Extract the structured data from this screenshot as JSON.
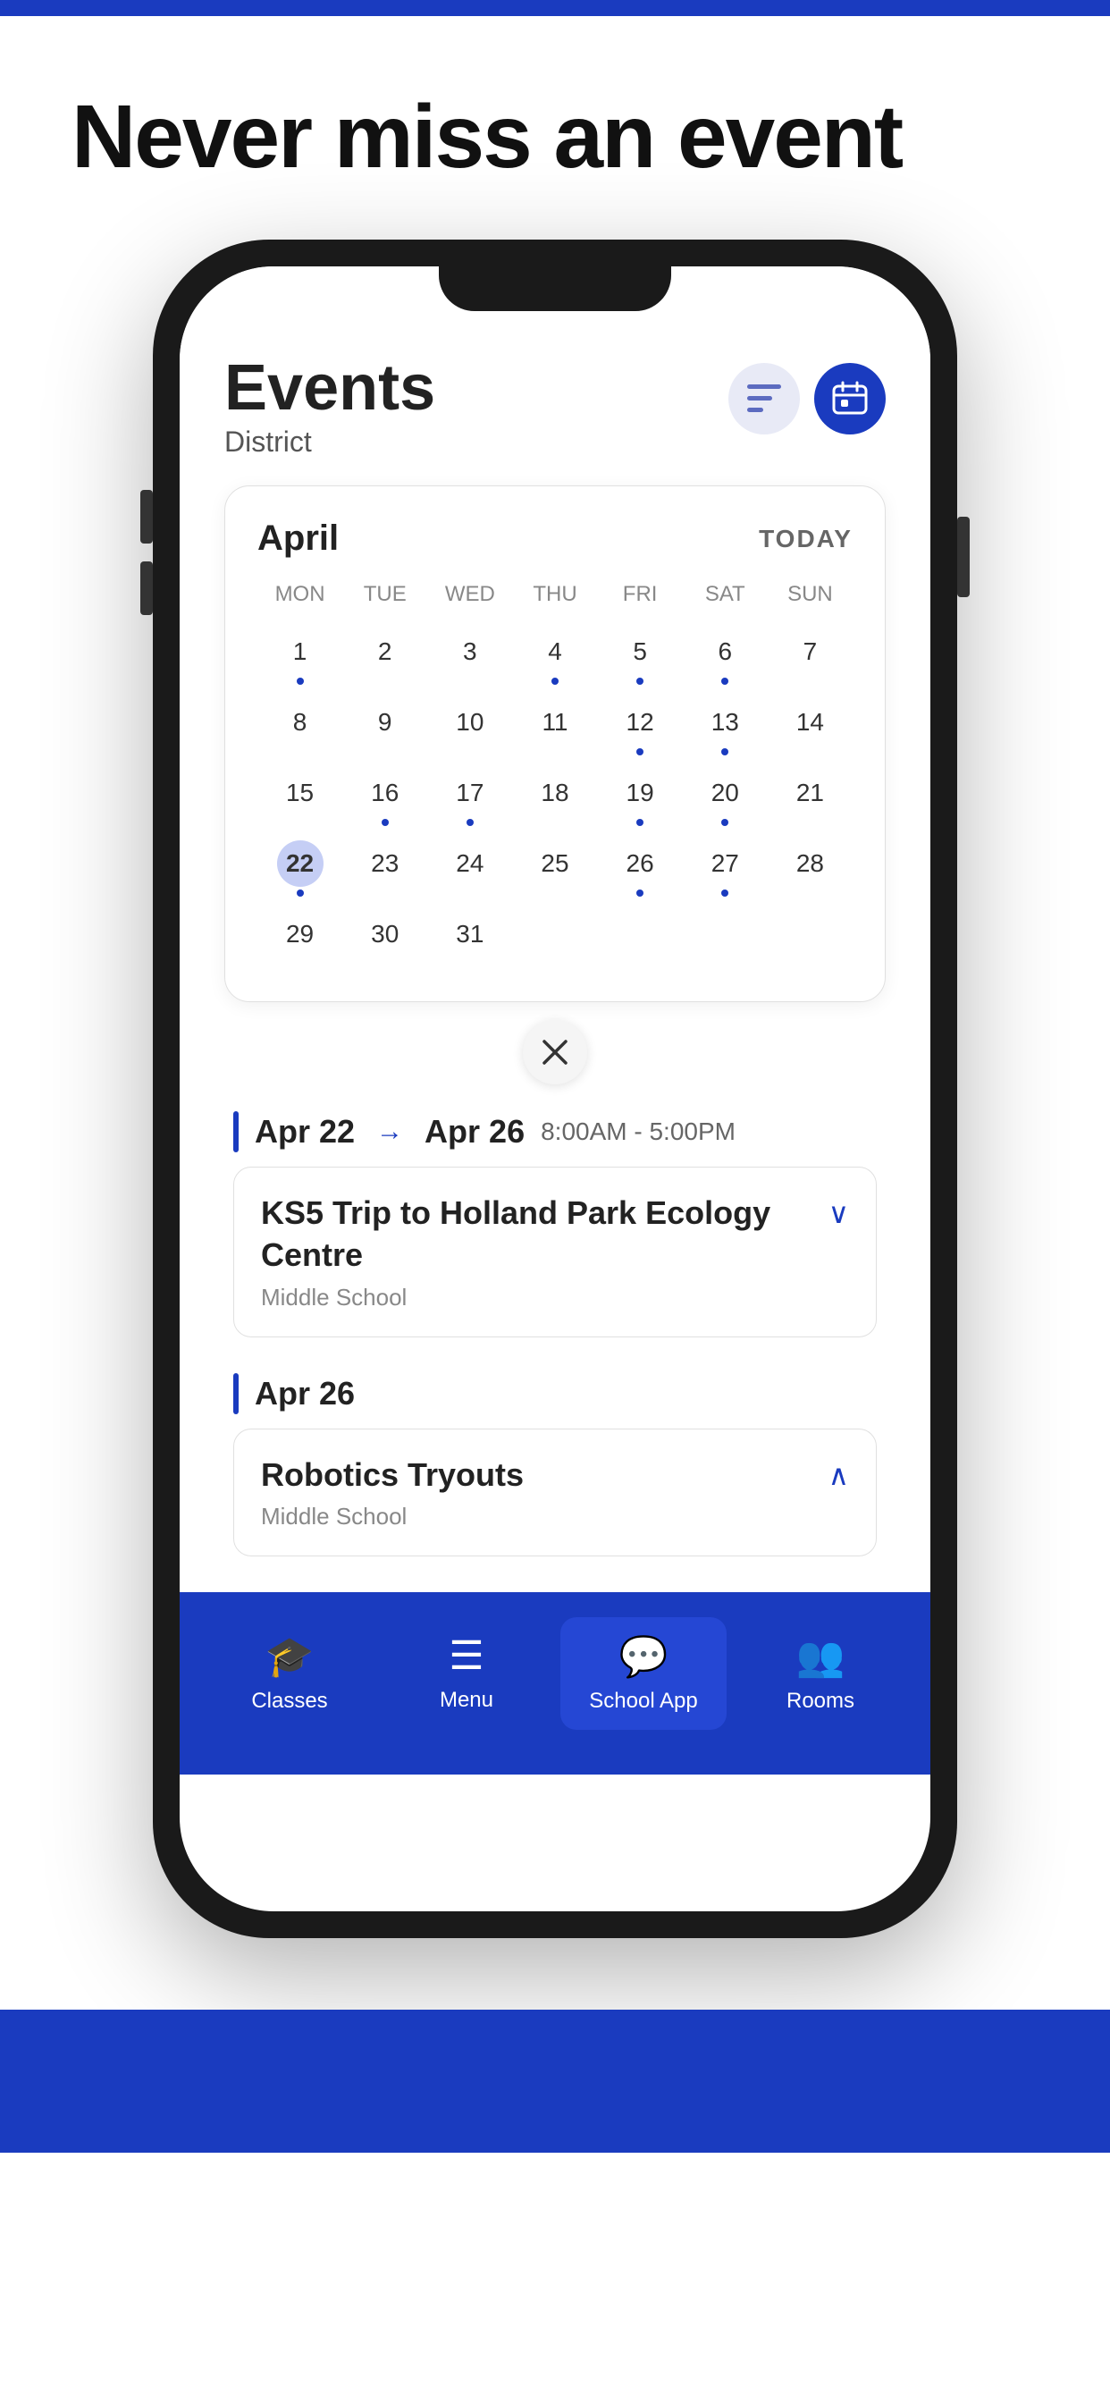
{
  "page": {
    "top_bar_color": "#1a3bbf",
    "headline": "Never miss an event",
    "bottom_bg_color": "#1a3bbf",
    "yellow_accent_color": "#f5a623"
  },
  "app": {
    "screen_title": "Events",
    "screen_subtitle": "District",
    "filter_button_label": "filter",
    "calendar_button_label": "calendar"
  },
  "calendar": {
    "month": "April",
    "today_label": "TODAY",
    "day_names": [
      "MON",
      "TUE",
      "WED",
      "THU",
      "FRI",
      "SAT",
      "SUN"
    ],
    "close_label": "×",
    "weeks": [
      [
        {
          "num": "1",
          "dot": true,
          "today": false,
          "empty": false
        },
        {
          "num": "2",
          "dot": false,
          "today": false,
          "empty": false
        },
        {
          "num": "3",
          "dot": false,
          "today": false,
          "empty": false
        },
        {
          "num": "4",
          "dot": true,
          "today": false,
          "empty": false
        },
        {
          "num": "5",
          "dot": true,
          "today": false,
          "empty": false
        },
        {
          "num": "6",
          "dot": true,
          "today": false,
          "empty": false
        },
        {
          "num": "7",
          "dot": false,
          "today": false,
          "empty": false
        }
      ],
      [
        {
          "num": "8",
          "dot": false,
          "today": false,
          "empty": false
        },
        {
          "num": "9",
          "dot": false,
          "today": false,
          "empty": false
        },
        {
          "num": "10",
          "dot": false,
          "today": false,
          "empty": false
        },
        {
          "num": "11",
          "dot": false,
          "today": false,
          "empty": false
        },
        {
          "num": "12",
          "dot": true,
          "today": false,
          "empty": false
        },
        {
          "num": "13",
          "dot": true,
          "today": false,
          "empty": false
        },
        {
          "num": "14",
          "dot": false,
          "today": false,
          "empty": false
        }
      ],
      [
        {
          "num": "15",
          "dot": false,
          "today": false,
          "empty": false
        },
        {
          "num": "16",
          "dot": true,
          "today": false,
          "empty": false
        },
        {
          "num": "17",
          "dot": true,
          "today": false,
          "empty": false
        },
        {
          "num": "18",
          "dot": false,
          "today": false,
          "empty": false
        },
        {
          "num": "19",
          "dot": true,
          "today": false,
          "empty": false
        },
        {
          "num": "20",
          "dot": true,
          "today": false,
          "empty": false
        },
        {
          "num": "21",
          "dot": false,
          "today": false,
          "empty": false
        }
      ],
      [
        {
          "num": "22",
          "dot": true,
          "today": true,
          "empty": false
        },
        {
          "num": "23",
          "dot": false,
          "today": false,
          "empty": false
        },
        {
          "num": "24",
          "dot": false,
          "today": false,
          "empty": false
        },
        {
          "num": "25",
          "dot": false,
          "today": false,
          "empty": false
        },
        {
          "num": "26",
          "dot": true,
          "today": false,
          "empty": false
        },
        {
          "num": "27",
          "dot": true,
          "today": false,
          "empty": false
        },
        {
          "num": "28",
          "dot": false,
          "today": false,
          "empty": false
        }
      ],
      [
        {
          "num": "29",
          "dot": false,
          "today": false,
          "empty": false
        },
        {
          "num": "30",
          "dot": false,
          "today": false,
          "empty": false
        },
        {
          "num": "31",
          "dot": false,
          "today": false,
          "empty": false
        },
        {
          "num": "",
          "dot": false,
          "today": false,
          "empty": true
        },
        {
          "num": "",
          "dot": false,
          "today": false,
          "empty": true
        },
        {
          "num": "",
          "dot": false,
          "today": false,
          "empty": true
        },
        {
          "num": "",
          "dot": false,
          "today": false,
          "empty": true
        }
      ]
    ]
  },
  "events": [
    {
      "date_start": "Apr 22",
      "date_end": "Apr 26",
      "time": "8:00AM  -  5:00PM",
      "title": "KS5 Trip to Holland Park Ecology Centre",
      "school": "Middle School",
      "expanded": false,
      "chevron": "∨"
    },
    {
      "date_start": "Apr 26",
      "date_end": null,
      "time": null,
      "title": "Robotics Tryouts",
      "school": "Middle School",
      "expanded": true,
      "chevron": "∧"
    }
  ],
  "bottom_nav": [
    {
      "label": "Classes",
      "icon": "🎓",
      "active": false
    },
    {
      "label": "Menu",
      "icon": "☰",
      "active": false
    },
    {
      "label": "School App",
      "icon": "💬",
      "active": true
    },
    {
      "label": "Rooms",
      "icon": "👥",
      "active": false
    }
  ]
}
